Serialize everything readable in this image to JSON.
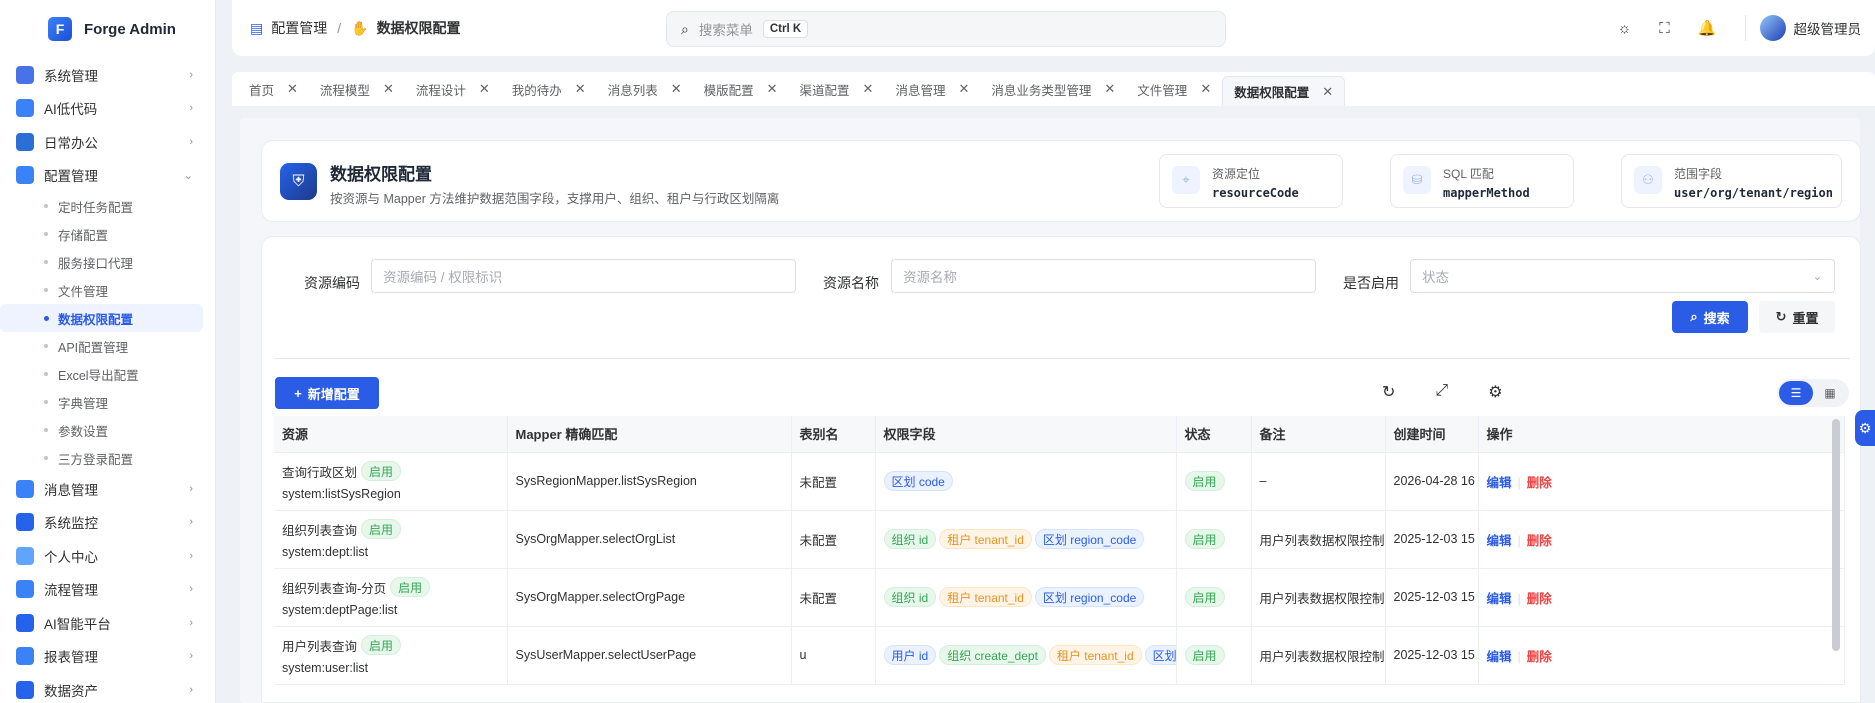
{
  "app": {
    "name": "Forge Admin",
    "logo_letter": "F"
  },
  "sidebar": {
    "menu_top": [
      {
        "label": "系统管理",
        "icon": "gear-icon",
        "color": "#4a72e8"
      },
      {
        "label": "AI低代码",
        "icon": "code-icon",
        "color": "#3b82f6"
      },
      {
        "label": "日常办公",
        "icon": "briefcase-icon",
        "color": "#2b6fd6"
      },
      {
        "label": "配置管理",
        "icon": "config-icon",
        "color": "#3b82f6"
      }
    ],
    "submenu": [
      "定时任务配置",
      "存储配置",
      "服务接口代理",
      "文件管理",
      "数据权限配置",
      "API配置管理",
      "Excel导出配置",
      "字典管理",
      "参数设置",
      "三方登录配置"
    ],
    "menu_bottom": [
      {
        "label": "消息管理",
        "icon": "message-icon",
        "color": "#3b82f6"
      },
      {
        "label": "系统监控",
        "icon": "monitor-icon",
        "color": "#2563eb"
      },
      {
        "label": "个人中心",
        "icon": "user-icon",
        "color": "#60a5fa"
      },
      {
        "label": "流程管理",
        "icon": "flow-icon",
        "color": "#3b82f6"
      },
      {
        "label": "AI智能平台",
        "icon": "ai-icon",
        "color": "#2563eb"
      },
      {
        "label": "报表管理",
        "icon": "report-icon",
        "color": "#3b82f6"
      },
      {
        "label": "数据资产",
        "icon": "data-icon",
        "color": "#2563eb"
      }
    ]
  },
  "header": {
    "breadcrumb": [
      "配置管理",
      "数据权限配置"
    ],
    "search_placeholder": "搜索菜单",
    "shortcut": "Ctrl K",
    "user_name": "超级管理员"
  },
  "tabs": [
    "首页",
    "流程模型",
    "流程设计",
    "我的待办",
    "消息列表",
    "模版配置",
    "渠道配置",
    "消息管理",
    "消息业务类型管理",
    "文件管理",
    "数据权限配置"
  ],
  "hero": {
    "title": "数据权限配置",
    "subtitle": "按资源与 Mapper 方法维护数据范围字段，支撑用户、组织、租户与行政区划隔离",
    "cards": [
      {
        "label": "资源定位",
        "value": "resourceCode"
      },
      {
        "label": "SQL 匹配",
        "value": "mapperMethod"
      },
      {
        "label": "范围字段",
        "value": "user/org/tenant/region"
      }
    ]
  },
  "filters": {
    "code_label": "资源编码",
    "code_placeholder": "资源编码 / 权限标识",
    "name_label": "资源名称",
    "name_placeholder": "资源名称",
    "enabled_label": "是否启用",
    "enabled_placeholder": "状态",
    "search_btn": "搜索",
    "reset_btn": "重置"
  },
  "toolbar": {
    "add_btn": "新增配置"
  },
  "table": {
    "columns": [
      "资源",
      "Mapper 精确匹配",
      "表别名",
      "权限字段",
      "状态",
      "备注",
      "创建时间",
      "操作"
    ],
    "rows": [
      {
        "name": "查询行政区划",
        "enabled": "启用",
        "code": "system:listSysRegion",
        "mapper": "SysRegionMapper.listSysRegion",
        "alias": "未配置",
        "fields": [
          {
            "t": "区划 code",
            "c": "blue"
          }
        ],
        "status": "启用",
        "remark": "–",
        "created": "2026-04-28 16",
        "edit": "编辑",
        "del": "删除"
      },
      {
        "name": "组织列表查询",
        "enabled": "启用",
        "code": "system:dept:list",
        "mapper": "SysOrgMapper.selectOrgList",
        "alias": "未配置",
        "fields": [
          {
            "t": "组织 id",
            "c": "green"
          },
          {
            "t": "租户 tenant_id",
            "c": "orange"
          },
          {
            "t": "区划 region_code",
            "c": "blue"
          }
        ],
        "status": "启用",
        "remark": "用户列表数据权限控制",
        "created": "2025-12-03 15",
        "edit": "编辑",
        "del": "删除"
      },
      {
        "name": "组织列表查询-分页",
        "enabled": "启用",
        "code": "system:deptPage:list",
        "mapper": "SysOrgMapper.selectOrgPage",
        "alias": "未配置",
        "fields": [
          {
            "t": "组织 id",
            "c": "green"
          },
          {
            "t": "租户 tenant_id",
            "c": "orange"
          },
          {
            "t": "区划 region_code",
            "c": "blue"
          }
        ],
        "status": "启用",
        "remark": "用户列表数据权限控制",
        "created": "2025-12-03 15",
        "edit": "编辑",
        "del": "删除"
      },
      {
        "name": "用户列表查询",
        "enabled": "启用",
        "code": "system:user:list",
        "mapper": "SysUserMapper.selectUserPage",
        "alias": "u",
        "fields": [
          {
            "t": "用户 id",
            "c": "blue"
          },
          {
            "t": "组织 create_dept",
            "c": "green"
          },
          {
            "t": "租户 tenant_id",
            "c": "orange"
          },
          {
            "t": "区划 region_code",
            "c": "blue"
          }
        ],
        "status": "启用",
        "remark": "用户列表数据权限控制",
        "created": "2025-12-03 15",
        "edit": "编辑",
        "del": "删除"
      }
    ]
  }
}
